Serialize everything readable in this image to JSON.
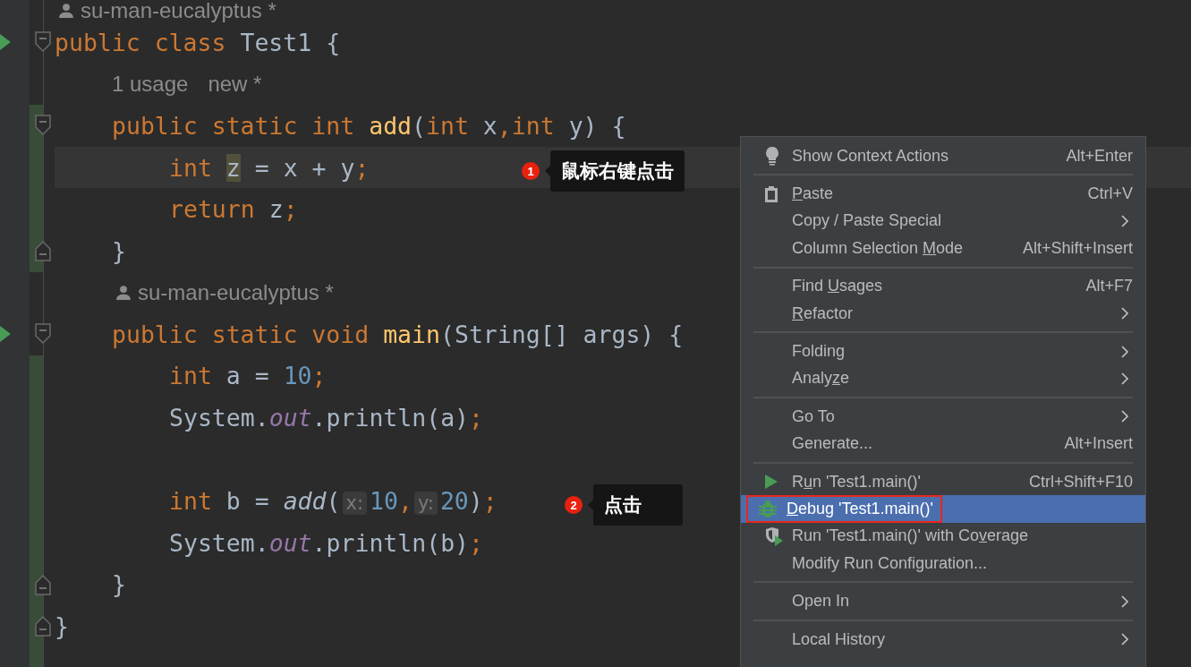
{
  "editor": {
    "lines": [
      {
        "kind": "annotation",
        "tokens": [
          {
            "kind": "author",
            "text": "su-man-eucalyptus *"
          }
        ]
      },
      {
        "kind": "code",
        "run": true,
        "fold_start": true,
        "fold_end": false,
        "changed": false,
        "current": false,
        "tokens": [
          {
            "kind": "keyword",
            "text": "public class "
          },
          {
            "kind": "plain",
            "text": "Test1 {"
          }
        ],
        "children": [
          {
            "kind": "annotation",
            "tokens": [
              {
                "kind": "meta",
                "text": "1 usage"
              },
              {
                "kind": "meta",
                "text": "new *"
              }
            ]
          },
          {
            "kind": "code",
            "run": false,
            "fold_start": true,
            "fold_end": false,
            "changed": true,
            "current": false,
            "tokens": [
              {
                "kind": "keyword",
                "text": "public static int "
              },
              {
                "kind": "function",
                "text": "add"
              },
              {
                "kind": "plain",
                "text": "("
              },
              {
                "kind": "keyword",
                "text": "int "
              },
              {
                "kind": "plain",
                "text": "x"
              },
              {
                "kind": "keyword",
                "text": ","
              },
              {
                "kind": "keyword",
                "text": "int "
              },
              {
                "kind": "plain",
                "text": "y) {"
              }
            ],
            "children": [
              {
                "kind": "code",
                "run": false,
                "fold_start": false,
                "fold_end": false,
                "changed": true,
                "current": true,
                "tokens": [
                  {
                    "kind": "keyword",
                    "text": "int "
                  },
                  {
                    "kind": "highlight",
                    "text": "z"
                  },
                  {
                    "kind": "plain",
                    "text": " = x + y"
                  },
                  {
                    "kind": "keyword",
                    "text": ";"
                  }
                ]
              },
              {
                "kind": "code",
                "run": false,
                "fold_start": false,
                "fold_end": false,
                "changed": true,
                "current": false,
                "tokens": [
                  {
                    "kind": "keyword",
                    "text": "return "
                  },
                  {
                    "kind": "plain",
                    "text": "z"
                  },
                  {
                    "kind": "keyword",
                    "text": ";"
                  }
                ]
              }
            ]
          },
          {
            "kind": "code",
            "run": false,
            "fold_start": false,
            "fold_end": true,
            "changed": true,
            "current": false,
            "tokens": [
              {
                "kind": "plain",
                "text": "}"
              }
            ]
          },
          {
            "kind": "annotation",
            "tokens": [
              {
                "kind": "author",
                "text": "su-man-eucalyptus *"
              }
            ]
          },
          {
            "kind": "code",
            "run": true,
            "fold_start": true,
            "fold_end": false,
            "changed": false,
            "current": false,
            "tokens": [
              {
                "kind": "keyword",
                "text": "public static void "
              },
              {
                "kind": "function",
                "text": "main"
              },
              {
                "kind": "plain",
                "text": "(String[] args) {"
              }
            ],
            "children": [
              {
                "kind": "code",
                "run": false,
                "fold_start": false,
                "fold_end": false,
                "changed": true,
                "current": false,
                "tokens": [
                  {
                    "kind": "keyword",
                    "text": "int "
                  },
                  {
                    "kind": "plain",
                    "text": "a = "
                  },
                  {
                    "kind": "number",
                    "text": "10"
                  },
                  {
                    "kind": "keyword",
                    "text": ";"
                  }
                ]
              },
              {
                "kind": "code",
                "run": false,
                "fold_start": false,
                "fold_end": false,
                "changed": true,
                "current": false,
                "tokens": [
                  {
                    "kind": "plain",
                    "text": "System."
                  },
                  {
                    "kind": "field",
                    "text": "out"
                  },
                  {
                    "kind": "plain",
                    "text": ".println(a)"
                  },
                  {
                    "kind": "keyword",
                    "text": ";"
                  }
                ]
              },
              {
                "kind": "code",
                "run": false,
                "fold_start": false,
                "fold_end": false,
                "changed": true,
                "current": false
              },
              {
                "kind": "code",
                "run": false,
                "fold_start": false,
                "fold_end": false,
                "changed": true,
                "current": false,
                "tokens": [
                  {
                    "kind": "keyword",
                    "text": "int "
                  },
                  {
                    "kind": "plain",
                    "text": "b = "
                  },
                  {
                    "kind": "call",
                    "text": "add"
                  },
                  {
                    "kind": "plain",
                    "text": "("
                  },
                  {
                    "kind": "hint",
                    "text": "x:"
                  },
                  {
                    "kind": "number",
                    "text": "10"
                  },
                  {
                    "kind": "keyword",
                    "text": ","
                  },
                  {
                    "kind": "hint",
                    "text": "y:"
                  },
                  {
                    "kind": "number",
                    "text": "20"
                  },
                  {
                    "kind": "plain",
                    "text": ")"
                  },
                  {
                    "kind": "keyword",
                    "text": ";"
                  }
                ]
              },
              {
                "kind": "code",
                "run": false,
                "fold_start": false,
                "fold_end": false,
                "changed": true,
                "current": false,
                "tokens": [
                  {
                    "kind": "plain",
                    "text": "System."
                  },
                  {
                    "kind": "field",
                    "text": "out"
                  },
                  {
                    "kind": "plain",
                    "text": ".println(b)"
                  },
                  {
                    "kind": "keyword",
                    "text": ";"
                  }
                ]
              }
            ]
          },
          {
            "kind": "code",
            "run": false,
            "fold_start": false,
            "fold_end": true,
            "changed": true,
            "current": false,
            "tokens": [
              {
                "kind": "plain",
                "text": "}"
              }
            ]
          }
        ]
      },
      {
        "kind": "code",
        "run": false,
        "fold_start": false,
        "fold_end": true,
        "changed": true,
        "current": false,
        "tokens": [
          {
            "kind": "plain",
            "text": "}"
          }
        ]
      }
    ]
  },
  "callouts": [
    {
      "number": "1",
      "text": "鼠标右键点击"
    },
    {
      "number": "2",
      "text": "点击"
    }
  ],
  "context_menu": {
    "items": [
      {
        "kind": "bulb",
        "label": "Show Context Actions",
        "shortcut": "Alt+Enter",
        "submenu": false,
        "selected": false,
        "outlined": false
      },
      {
        "kind": "separator"
      },
      {
        "kind": "clipboard",
        "key": "P",
        "after": "aste",
        "shortcut": "Ctrl+V",
        "submenu": false,
        "selected": false,
        "outlined": false
      },
      {
        "kind": "plain",
        "label": "Copy / Paste Special",
        "submenu": true,
        "selected": false,
        "outlined": false
      },
      {
        "kind": "plain",
        "before": "Column Selection ",
        "key": "M",
        "after": "ode",
        "shortcut": "Alt+Shift+Insert",
        "submenu": false,
        "selected": false,
        "outlined": false
      },
      {
        "kind": "separator"
      },
      {
        "kind": "plain",
        "before": "Find ",
        "key": "U",
        "after": "sages",
        "shortcut": "Alt+F7",
        "submenu": false,
        "selected": false,
        "outlined": false
      },
      {
        "kind": "plain",
        "key": "R",
        "after": "efactor",
        "submenu": true,
        "selected": false,
        "outlined": false
      },
      {
        "kind": "separator"
      },
      {
        "kind": "plain",
        "label": "Folding",
        "submenu": true,
        "selected": false,
        "outlined": false
      },
      {
        "kind": "plain",
        "before": "Analy",
        "key": "z",
        "after": "e",
        "submenu": true,
        "selected": false,
        "outlined": false
      },
      {
        "kind": "separator"
      },
      {
        "kind": "plain",
        "label": "Go To",
        "submenu": true,
        "selected": false,
        "outlined": false
      },
      {
        "kind": "plain",
        "label": "Generate...",
        "shortcut": "Alt+Insert",
        "submenu": false,
        "selected": false,
        "outlined": false
      },
      {
        "kind": "separator"
      },
      {
        "kind": "run",
        "before": "R",
        "key": "u",
        "after": "n 'Test1.main()'",
        "shortcut": "Ctrl+Shift+F10",
        "submenu": false,
        "selected": false,
        "outlined": false
      },
      {
        "kind": "debug",
        "key": "D",
        "after": "ebug 'Test1.main()'",
        "submenu": false,
        "selected": true,
        "outlined": true
      },
      {
        "kind": "coverage",
        "before": "Run 'Test1.main()' with Co",
        "key": "v",
        "after": "erage",
        "submenu": false,
        "selected": false,
        "outlined": false
      },
      {
        "kind": "plain",
        "label": "Modify Run Configuration...",
        "submenu": false,
        "selected": false,
        "outlined": false
      },
      {
        "kind": "separator"
      },
      {
        "kind": "plain",
        "label": "Open In",
        "submenu": true,
        "selected": false,
        "outlined": false
      },
      {
        "kind": "separator"
      },
      {
        "kind": "plain",
        "label": "Local History",
        "submenu": true,
        "selected": false,
        "outlined": false
      }
    ]
  }
}
